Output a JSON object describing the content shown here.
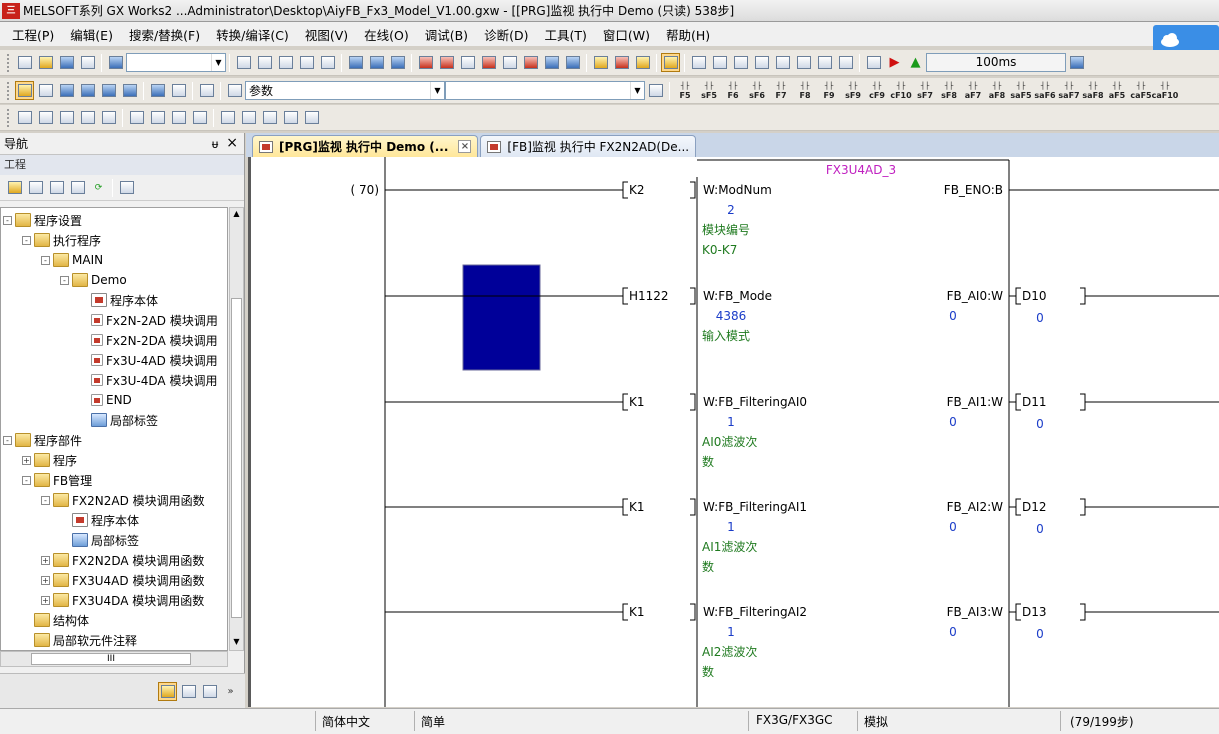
{
  "window": {
    "title": "MELSOFT系列 GX Works2 ...Administrator\\Desktop\\AiyFB_Fx3_Model_V1.00.gxw - [[PRG]监视 执行中 Demo (只读) 538步]",
    "logo_text": "三"
  },
  "menu": [
    "工程(P)",
    "编辑(E)",
    "搜索/替换(F)",
    "转换/编译(C)",
    "视图(V)",
    "在线(O)",
    "调试(B)",
    "诊断(D)",
    "工具(T)",
    "窗口(W)",
    "帮助(H)"
  ],
  "toolbar": {
    "search_combo_value": "参数",
    "timer_value": "100ms",
    "fkeys": [
      "F5",
      "sF5",
      "F6",
      "sF6",
      "F7",
      "F8",
      "F9",
      "sF9",
      "cF9",
      "cF10",
      "sF7",
      "sF8",
      "aF7",
      "aF8",
      "saF5",
      "saF6",
      "saF7",
      "saF8",
      "aF5",
      "caF5",
      "caF10"
    ]
  },
  "nav": {
    "title": "导航",
    "pin": "ᵾ",
    "close": "×",
    "section": "工程",
    "hscroll_text": "III",
    "tree": [
      {
        "label": "程序设置",
        "depth": 0,
        "toggle": "-",
        "icon": "folder"
      },
      {
        "label": "执行程序",
        "depth": 1,
        "toggle": "-",
        "icon": "folder"
      },
      {
        "label": "MAIN",
        "depth": 2,
        "toggle": "-",
        "icon": "folder"
      },
      {
        "label": "Demo",
        "depth": 3,
        "toggle": "-",
        "icon": "folder"
      },
      {
        "label": "程序本体",
        "depth": 4,
        "toggle": "",
        "icon": "prog"
      },
      {
        "label": "Fx2N-2AD 模块调用",
        "depth": 4,
        "toggle": "",
        "icon": "small"
      },
      {
        "label": "Fx2N-2DA 模块调用",
        "depth": 4,
        "toggle": "",
        "icon": "small"
      },
      {
        "label": "Fx3U-4AD 模块调用",
        "depth": 4,
        "toggle": "",
        "icon": "small"
      },
      {
        "label": "Fx3U-4DA 模块调用",
        "depth": 4,
        "toggle": "",
        "icon": "small"
      },
      {
        "label": "END",
        "depth": 4,
        "toggle": "",
        "icon": "small"
      },
      {
        "label": "局部标签",
        "depth": 4,
        "toggle": "",
        "icon": "label"
      },
      {
        "label": "程序部件",
        "depth": 0,
        "toggle": "-",
        "icon": "folder"
      },
      {
        "label": "程序",
        "depth": 1,
        "toggle": "+",
        "icon": "folder"
      },
      {
        "label": "FB管理",
        "depth": 1,
        "toggle": "-",
        "icon": "folder"
      },
      {
        "label": "FX2N2AD 模块调用函数",
        "depth": 2,
        "toggle": "-",
        "icon": "folder"
      },
      {
        "label": "程序本体",
        "depth": 3,
        "toggle": "",
        "icon": "prog"
      },
      {
        "label": "局部标签",
        "depth": 3,
        "toggle": "",
        "icon": "label"
      },
      {
        "label": "FX2N2DA 模块调用函数",
        "depth": 2,
        "toggle": "+",
        "icon": "folder"
      },
      {
        "label": "FX3U4AD 模块调用函数",
        "depth": 2,
        "toggle": "+",
        "icon": "folder"
      },
      {
        "label": "FX3U4DA 模块调用函数",
        "depth": 2,
        "toggle": "+",
        "icon": "folder"
      },
      {
        "label": "结构体",
        "depth": 1,
        "toggle": "",
        "icon": "folder"
      },
      {
        "label": "局部软元件注释",
        "depth": 1,
        "toggle": "",
        "icon": "folder"
      }
    ]
  },
  "tabs": [
    {
      "label": "[PRG]监视 执行中 Demo (...",
      "active": true
    },
    {
      "label": "[FB]监视 执行中 FX2N2AD(De...",
      "active": false
    }
  ],
  "tab_close": "×",
  "ladder": {
    "step": "( 70)",
    "fb_name": "FX3U4AD_3",
    "inputs": [
      {
        "const": "K2",
        "name": "W:ModNum",
        "value": "2",
        "comment": [
          "模块编号",
          "K0-K7"
        ]
      },
      {
        "const": "H1122",
        "name": "W:FB_Mode",
        "value": "4386",
        "comment": [
          "输入模式"
        ]
      },
      {
        "const": "K1",
        "name": "W:FB_FilteringAI0",
        "value": "1",
        "comment": [
          "AI0滤波次",
          "数"
        ]
      },
      {
        "const": "K1",
        "name": "W:FB_FilteringAI1",
        "value": "1",
        "comment": [
          "AI1滤波次",
          "数"
        ]
      },
      {
        "const": "K1",
        "name": "W:FB_FilteringAI2",
        "value": "1",
        "comment": [
          "AI2滤波次",
          "数"
        ]
      }
    ],
    "outputs": [
      {
        "name": "FB_ENO:B",
        "value": "",
        "device": "",
        "dev_value": ""
      },
      {
        "name": "FB_AI0:W",
        "value": "0",
        "device": "D10",
        "dev_value": "0"
      },
      {
        "name": "FB_AI1:W",
        "value": "0",
        "device": "D11",
        "dev_value": "0"
      },
      {
        "name": "FB_AI2:W",
        "value": "0",
        "device": "D12",
        "dev_value": "0"
      },
      {
        "name": "FB_AI3:W",
        "value": "0",
        "device": "D13",
        "dev_value": "0"
      }
    ],
    "colors": {
      "fb_name": "#c020c0",
      "value": "#1a3cc8",
      "comment": "#1f7a1f",
      "cursor": "#000099"
    }
  },
  "status": {
    "lang": "简体中文",
    "mode": "简单",
    "plc": "FX3G/FX3GC",
    "sim": "模拟",
    "steps": "(79/199步)"
  }
}
